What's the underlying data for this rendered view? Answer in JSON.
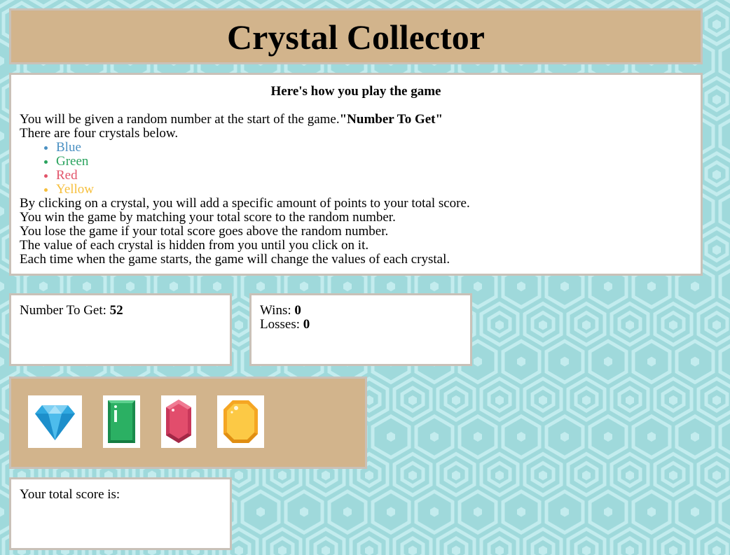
{
  "header": {
    "title": "Crystal Collector"
  },
  "instructions": {
    "heading": "Here's how you play the game",
    "intro": "You will be given a random number at the start of the game.",
    "intro_bold": "\"Number To Get\"",
    "four_crystals": "There are four crystals below.",
    "crystals": [
      {
        "label": "Blue",
        "color": "#4a90c2"
      },
      {
        "label": "Green",
        "color": "#2aa35e"
      },
      {
        "label": "Red",
        "color": "#e2546a"
      },
      {
        "label": "Yellow",
        "color": "#f6bf3c"
      }
    ],
    "rules": [
      "By clicking on a crystal, you will add a specific amount of points to your total score.",
      "You win the game by matching your total score to the random number.",
      "You lose the game if your total score goes above the random number.",
      "The value of each crystal is hidden from you until you click on it.",
      "Each time when the game starts, the game will change the values of each crystal."
    ]
  },
  "target": {
    "label": "Number To Get: ",
    "value": "52"
  },
  "stats": {
    "wins_label": "Wins: ",
    "wins": "0",
    "losses_label": "Losses: ",
    "losses": "0"
  },
  "crystal_buttons": [
    {
      "icon": "blue-diamond-icon"
    },
    {
      "icon": "green-emerald-icon"
    },
    {
      "icon": "red-ruby-icon"
    },
    {
      "icon": "yellow-topaz-icon"
    }
  ],
  "score": {
    "label": "Your total score is:"
  },
  "colors": {
    "background": "#9fd9db",
    "panel_tan": "#d2b48c",
    "panel_border": "#c9c1b8"
  }
}
